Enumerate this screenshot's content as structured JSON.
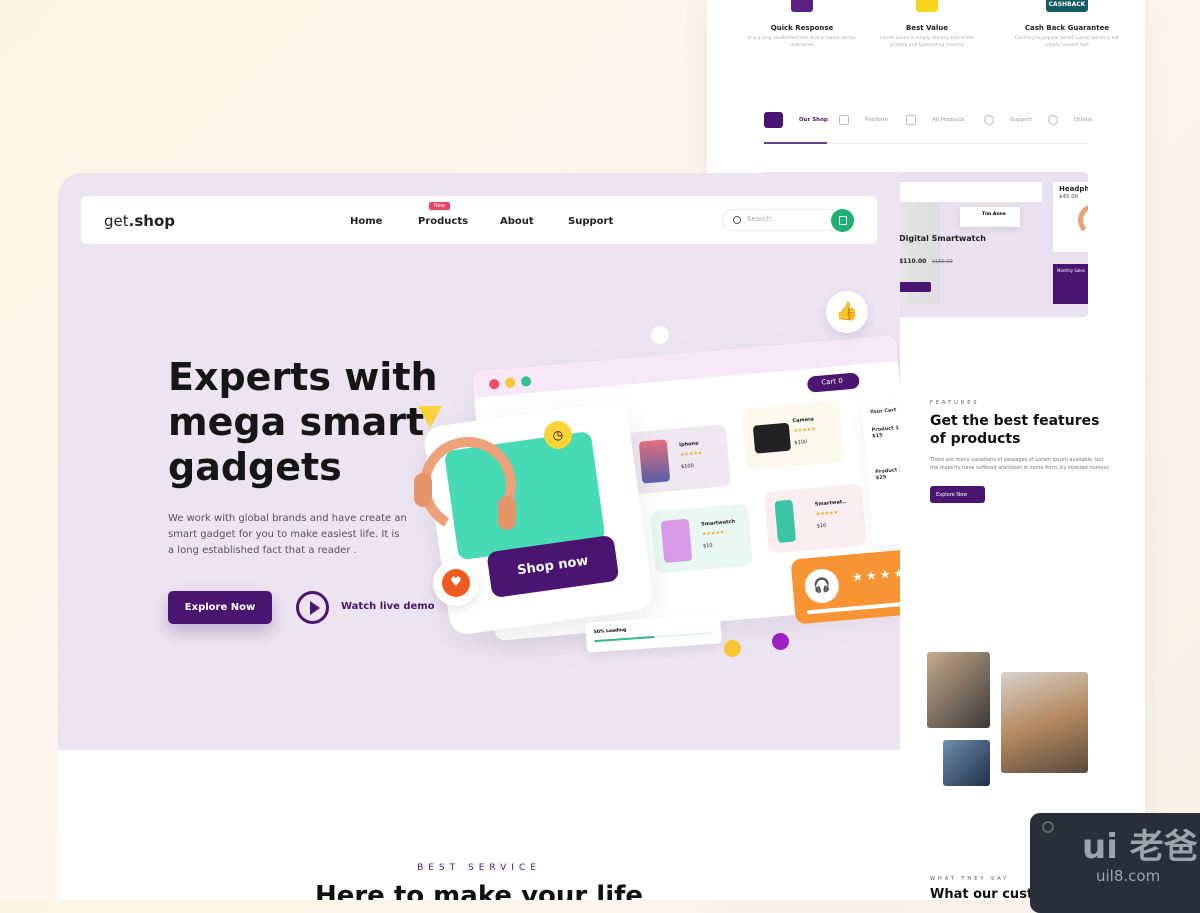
{
  "back_page": {
    "features": [
      {
        "title": "Quick Response",
        "text": "It is a long established fact that a reader will be distracted",
        "color": "#5a1f84"
      },
      {
        "title": "Best Value",
        "text": "Lorem Ipsum is simply dummy text of the printing and typesetting industry",
        "color": "#f8d51d"
      },
      {
        "title": "Cash Back Guarantee",
        "text": "Contrary to popular belief, Lorem Ipsum is not simply random text",
        "badge": "CASHBACK",
        "color": "#145a66"
      }
    ],
    "tabs": [
      "Our Shop",
      "Platform",
      "All Products",
      "Support",
      "Others"
    ],
    "preview": {
      "product_title": "Digital Smartwatch",
      "price": "$110.00",
      "old_price": "$150.00",
      "headphone_title": "Headphone",
      "headphone_price": "$45.00",
      "user_name": "Tim Anne",
      "chart_title": "Monthly Sales"
    },
    "features_section": {
      "label": "FEATURES",
      "title": "Get the best features of products",
      "text": "There are many variations of passages of Lorem Ipsum available, but the majority have suffered alteration in some form, by injected humour",
      "button": "Explore Now"
    },
    "testimonials": {
      "label": "WHAT THEY SAY",
      "title": "What our cust"
    }
  },
  "nav": {
    "logo_a": "get",
    "logo_b": ".shop",
    "links": [
      "Home",
      "Products",
      "About",
      "Support"
    ],
    "new_badge": "New",
    "search_placeholder": "Search.."
  },
  "hero": {
    "title": "Experts with mega smart gadgets",
    "description": "We work with global brands and have create an smart gadget for you to make easiest life. It is a long established fact that a reader .",
    "explore": "Explore Now",
    "watch": "Watch live demo"
  },
  "illustration": {
    "cart": "Cart",
    "cart_count": "0",
    "your_cart": "Your Cart",
    "products": [
      {
        "name": "Iphone",
        "price": "$100"
      },
      {
        "name": "Camera",
        "price": "$100"
      },
      {
        "name": "Smartwatch",
        "price": "$10"
      },
      {
        "name": "Smartwat..",
        "price": "$10"
      }
    ],
    "cart_items": [
      {
        "name": "Product 1",
        "price": "$15"
      },
      {
        "name": "Product 2",
        "price": "$25"
      }
    ],
    "shop_now": "Shop now",
    "stars": "★★★★★",
    "loading": "50% Loading",
    "loading_progress": 0.5,
    "accent": "#4a1570",
    "teal": "#46dbb5",
    "orange": "#f79534"
  },
  "service": {
    "label": "BEST SERVICE",
    "title": "Here to make your life"
  },
  "watermark": {
    "big": "ui 老爸",
    "small": "uil8.com"
  }
}
